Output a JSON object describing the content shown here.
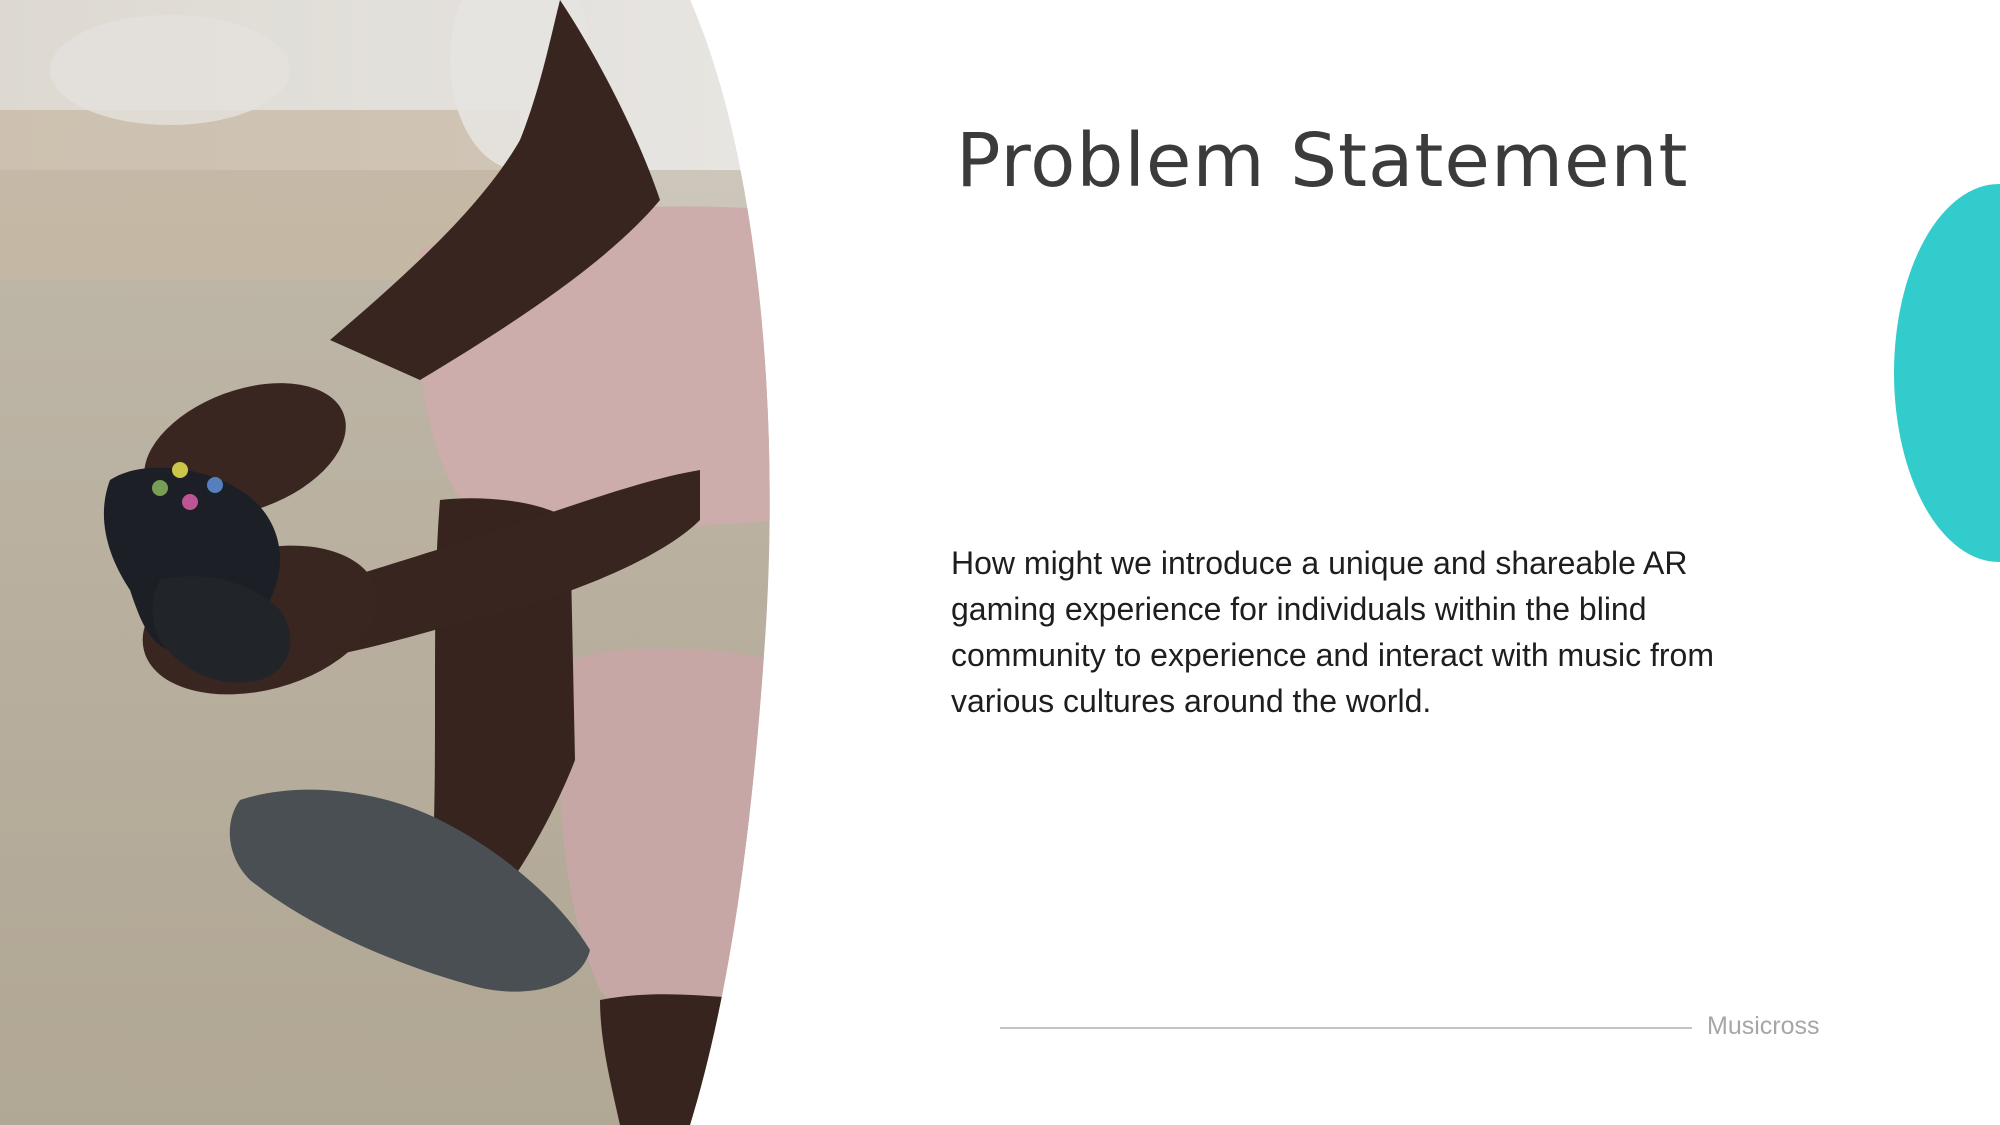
{
  "slide": {
    "title": "Problem Statement",
    "body": "How might we introduce a unique and shareable AR gaming experience for individuals within the blind community to experience and interact with music from various cultures around the world.",
    "footer": "Musicross"
  },
  "photo": {
    "subject": "person-holding-game-controller-photo"
  },
  "colors": {
    "accent": "#33cccc",
    "title": "#3b3b3b",
    "body": "#1e1e1e",
    "footer_text": "#a6a6a6",
    "footer_rule": "#c4c4c4",
    "background": "#ffffff"
  }
}
